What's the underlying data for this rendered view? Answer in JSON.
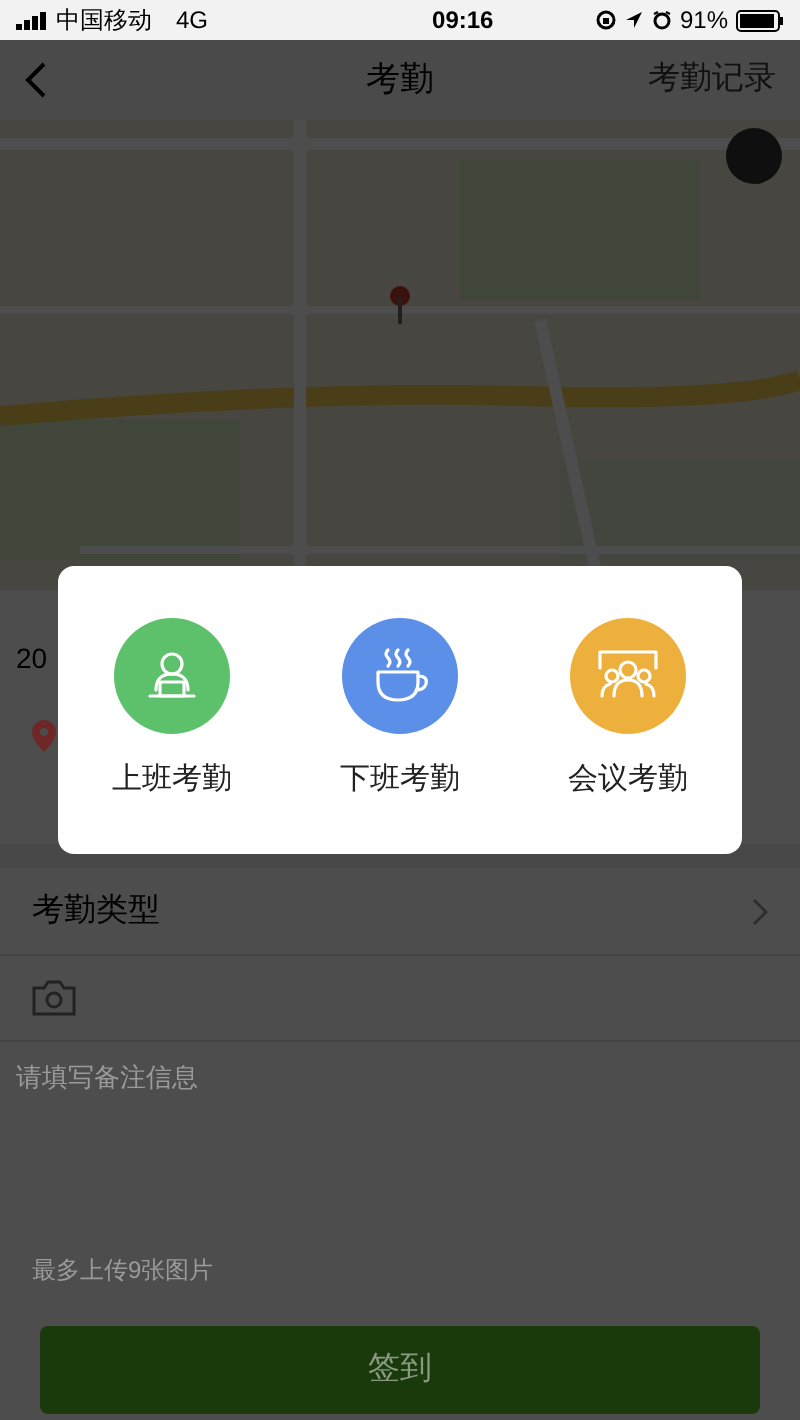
{
  "status_bar": {
    "carrier": "中国移动",
    "network": "4G",
    "time": "09:16",
    "battery": "91%"
  },
  "nav": {
    "title": "考勤",
    "action": "考勤记录"
  },
  "form": {
    "date_text": "20",
    "type_label": "考勤类型",
    "remark_placeholder": "请填写备注信息",
    "upload_hint": "最多上传9张图片",
    "submit": "签到"
  },
  "dialog": {
    "options": [
      {
        "label": "上班考勤",
        "kind": "clock_in",
        "color": "#5cc16a"
      },
      {
        "label": "下班考勤",
        "kind": "clock_out",
        "color": "#5b8fe8"
      },
      {
        "label": "会议考勤",
        "kind": "meeting",
        "color": "#edb03d"
      }
    ]
  }
}
